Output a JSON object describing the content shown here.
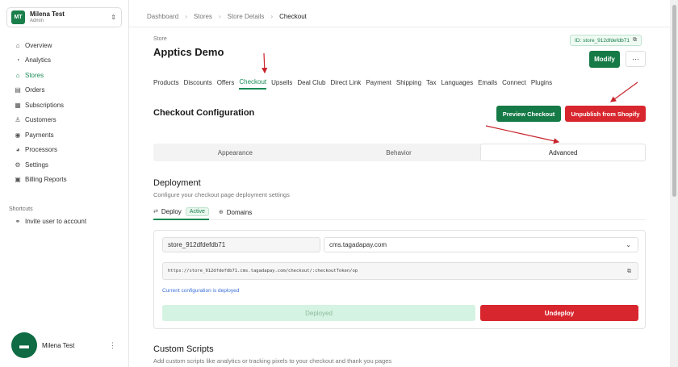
{
  "account": {
    "initials": "MT",
    "name": "Milena Test",
    "role": "Admin"
  },
  "nav": {
    "items": [
      {
        "label": "Overview",
        "icon": "home-icon"
      },
      {
        "label": "Analytics",
        "icon": "chart-icon"
      },
      {
        "label": "Stores",
        "icon": "store-icon"
      },
      {
        "label": "Orders",
        "icon": "cart-icon"
      },
      {
        "label": "Subscriptions",
        "icon": "subscriptions-icon"
      },
      {
        "label": "Customers",
        "icon": "users-icon"
      },
      {
        "label": "Payments",
        "icon": "payments-icon"
      },
      {
        "label": "Processors",
        "icon": "processors-icon"
      },
      {
        "label": "Settings",
        "icon": "gear-icon"
      },
      {
        "label": "Billing Reports",
        "icon": "report-icon"
      }
    ]
  },
  "shortcuts": {
    "title": "Shortcuts",
    "invite": "Invite user to account"
  },
  "footer": {
    "name": "Milena Test"
  },
  "breadcrumb": [
    "Dashboard",
    "Stores",
    "Store Details",
    "Checkout"
  ],
  "store": {
    "label": "Store",
    "title": "Apptics Demo",
    "id": "ID: store_912dfdefdb71",
    "modify": "Modify"
  },
  "tabs": [
    "Products",
    "Discounts",
    "Offers",
    "Checkout",
    "Upsells",
    "Deal Club",
    "Direct Link",
    "Payment",
    "Shipping",
    "Tax",
    "Languages",
    "Emails",
    "Connect",
    "Plugins"
  ],
  "checkout": {
    "title": "Checkout Configuration",
    "preview": "Preview Checkout",
    "unpublish": "Unpublish from Shopify",
    "segments": [
      "Appearance",
      "Behavior",
      "Advanced"
    ]
  },
  "deployment": {
    "title": "Deployment",
    "description": "Configure your checkout page deployment settings",
    "subtab_deploy": "Deploy",
    "active_badge": "Active",
    "subtab_domains": "Domains",
    "store_field": "store_912dfdefdb71",
    "domain_select": "cms.tagadapay.com",
    "url": "https://store_912dfdefdb71.cms.tagadapay.com/checkout/:checkoutToken/op",
    "status": "Current configuration is deployed",
    "deployed": "Deployed",
    "undeploy": "Undeploy"
  },
  "custom_scripts": {
    "title": "Custom Scripts",
    "description": "Add custom scripts like analytics or tracking pixels to your checkout and thank you pages"
  },
  "colors": {
    "accent": "#167a46",
    "danger": "#d8262e",
    "annotation": "#c8232b"
  }
}
